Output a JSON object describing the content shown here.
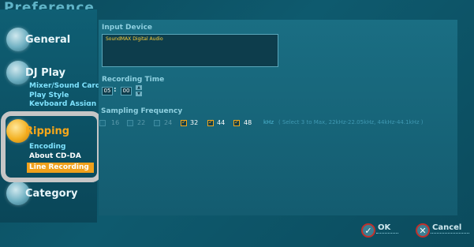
{
  "app_title": "Preference",
  "sidebar": {
    "sections": [
      {
        "label": "General",
        "icon": "disc-icon"
      },
      {
        "label": "DJ Play",
        "icon": "disc-icon",
        "items": [
          "Mixer/Sound Card",
          "Play Style",
          "Keyboard Assign"
        ]
      },
      {
        "label": "Ripping",
        "icon": "disc-icon",
        "active": true,
        "items": [
          "Encoding",
          "About CD-DA",
          "Line Recording"
        ],
        "selected_item": "Line Recording"
      },
      {
        "label": "Category",
        "icon": "disc-icon"
      }
    ]
  },
  "main": {
    "input_device": {
      "label": "Input Device",
      "value": "SoundMAX Digital Audio"
    },
    "recording_time": {
      "label": "Recording Time",
      "hours": "05",
      "minutes": "00"
    },
    "sampling_frequency": {
      "label": "Sampling Frequency",
      "options": [
        {
          "label": "16",
          "checked": false
        },
        {
          "label": "22",
          "checked": false
        },
        {
          "label": "24",
          "checked": false
        },
        {
          "label": "32",
          "checked": true
        },
        {
          "label": "44",
          "checked": true
        },
        {
          "label": "48",
          "checked": true
        }
      ],
      "unit": "kHz",
      "hint": "( Select 3 to Max, 22kHz-22.05kHz, 44kHz-44.1kHz )"
    }
  },
  "buttons": {
    "ok": "OK",
    "cancel": "Cancel"
  },
  "colors": {
    "accent": "#f0a01b",
    "background": "#0e5a6e",
    "button_ring": "#c0302c",
    "highlight_frame": "#c6c6c6"
  }
}
